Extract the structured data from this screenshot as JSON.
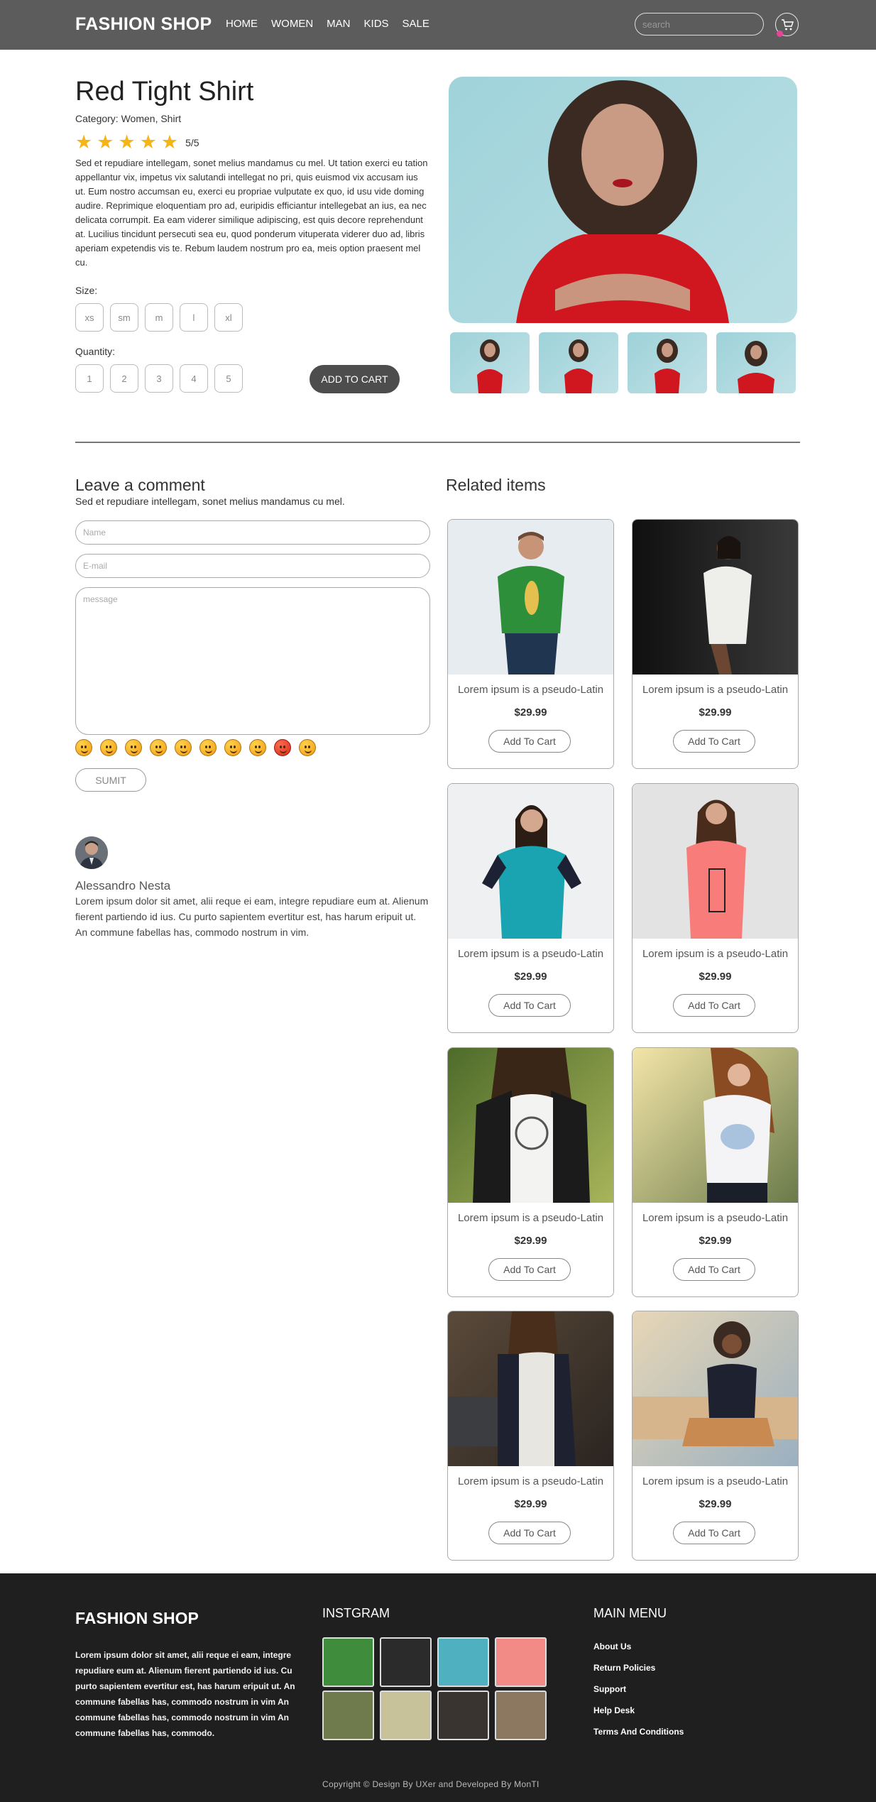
{
  "header": {
    "logo": "FASHION SHOP",
    "nav": [
      "HOME",
      "WOMEN",
      "MAN",
      "KIDS",
      "SALE"
    ],
    "search_placeholder": "search",
    "cart_icon": "cart-icon",
    "notification_dot_color": "#e8439a"
  },
  "product": {
    "title": "Red Tight Shirt",
    "category": "Category: Women, Shirt",
    "rating_stars": 5,
    "rating_text": "5/5",
    "star_color": "#f5b516",
    "description": "Sed et repudiare intellegam, sonet melius mandamus cu mel. Ut tation exerci eu tation appellantur vix, impetus vix salutandi intellegat no pri, quis euismod vix accusam ius ut. Eum nostro accumsan eu, exerci eu propriae vulputate ex quo, id usu vide doming audire. Reprimique eloquentiam pro ad, euripidis efficiantur intellegebat an ius, ea nec delicata corrumpit. Ea eam viderer similique adipiscing, est quis decore reprehendunt at. Lucilius tincidunt persecuti sea eu, quod ponderum vituperata viderer duo ad, libris aperiam expetendis vis te. Rebum laudem nostrum pro ea, meis option praesent mel cu.",
    "size_label": "Size:",
    "sizes": [
      "xs",
      "sm",
      "m",
      "l",
      "xl"
    ],
    "quantity_label": "Quantity:",
    "quantities": [
      "1",
      "2",
      "3",
      "4",
      "5"
    ],
    "add_to_cart": "ADD TO CART"
  },
  "comment_form": {
    "heading": "Leave a comment",
    "subtitle": "Sed et repudiare intellegam, sonet melius mandamus cu mel.",
    "name_placeholder": "Name",
    "email_placeholder": "E-mail",
    "message_placeholder": "message",
    "emojis": [
      "laughing-tears-icon",
      "smiling-icon",
      "sunglasses-icon",
      "grinning-icon",
      "crying-icon",
      "heart-eyes-icon",
      "tongue-out-icon",
      "happy-icon",
      "angry-icon",
      "blushing-icon"
    ],
    "submit": "SUMIT"
  },
  "comment": {
    "author": "Alessandro Nesta",
    "text": "Lorem ipsum dolor sit amet, alii reque ei eam, integre repudiare eum at. Alienum fierent partiendo id ius. Cu purto sapientem evertitur est, has harum eripuit ut. An commune fabellas has, commodo nostrum in vim."
  },
  "related": {
    "heading": "Related items",
    "items": [
      {
        "title": "Lorem ipsum is a pseudo-Latin",
        "price": "$29.99",
        "button": "Add To Cart"
      },
      {
        "title": "Lorem ipsum is a pseudo-Latin",
        "price": "$29.99",
        "button": "Add To Cart"
      },
      {
        "title": "Lorem ipsum is a pseudo-Latin",
        "price": "$29.99",
        "button": "Add To Cart"
      },
      {
        "title": "Lorem ipsum is a pseudo-Latin",
        "price": "$29.99",
        "button": "Add To Cart"
      },
      {
        "title": "Lorem ipsum is a pseudo-Latin",
        "price": "$29.99",
        "button": "Add To Cart"
      },
      {
        "title": "Lorem ipsum is a pseudo-Latin",
        "price": "$29.99",
        "button": "Add To Cart"
      },
      {
        "title": "Lorem ipsum is a pseudo-Latin",
        "price": "$29.99",
        "button": "Add To Cart"
      },
      {
        "title": "Lorem ipsum is a pseudo-Latin",
        "price": "$29.99",
        "button": "Add To Cart"
      }
    ]
  },
  "footer": {
    "logo": "FASHION SHOP",
    "about": "Lorem ipsum dolor sit amet, alii reque ei eam, integre repudiare eum at. Alienum fierent partiendo id ius. Cu purto sapientem evertitur est, has harum eripuit ut. An commune fabellas has, commodo nostrum in vim An commune fabellas has, commodo nostrum in vim An commune fabellas has, commodo.",
    "instagram_heading": "INSTGRAM",
    "menu_heading": "MAIN MENU",
    "menu": [
      "About Us",
      "Return Policies",
      "Support",
      "Help Desk",
      "Terms And Conditions"
    ],
    "copyright": "Copyright © Design By UXer and Developed By MonTI"
  }
}
